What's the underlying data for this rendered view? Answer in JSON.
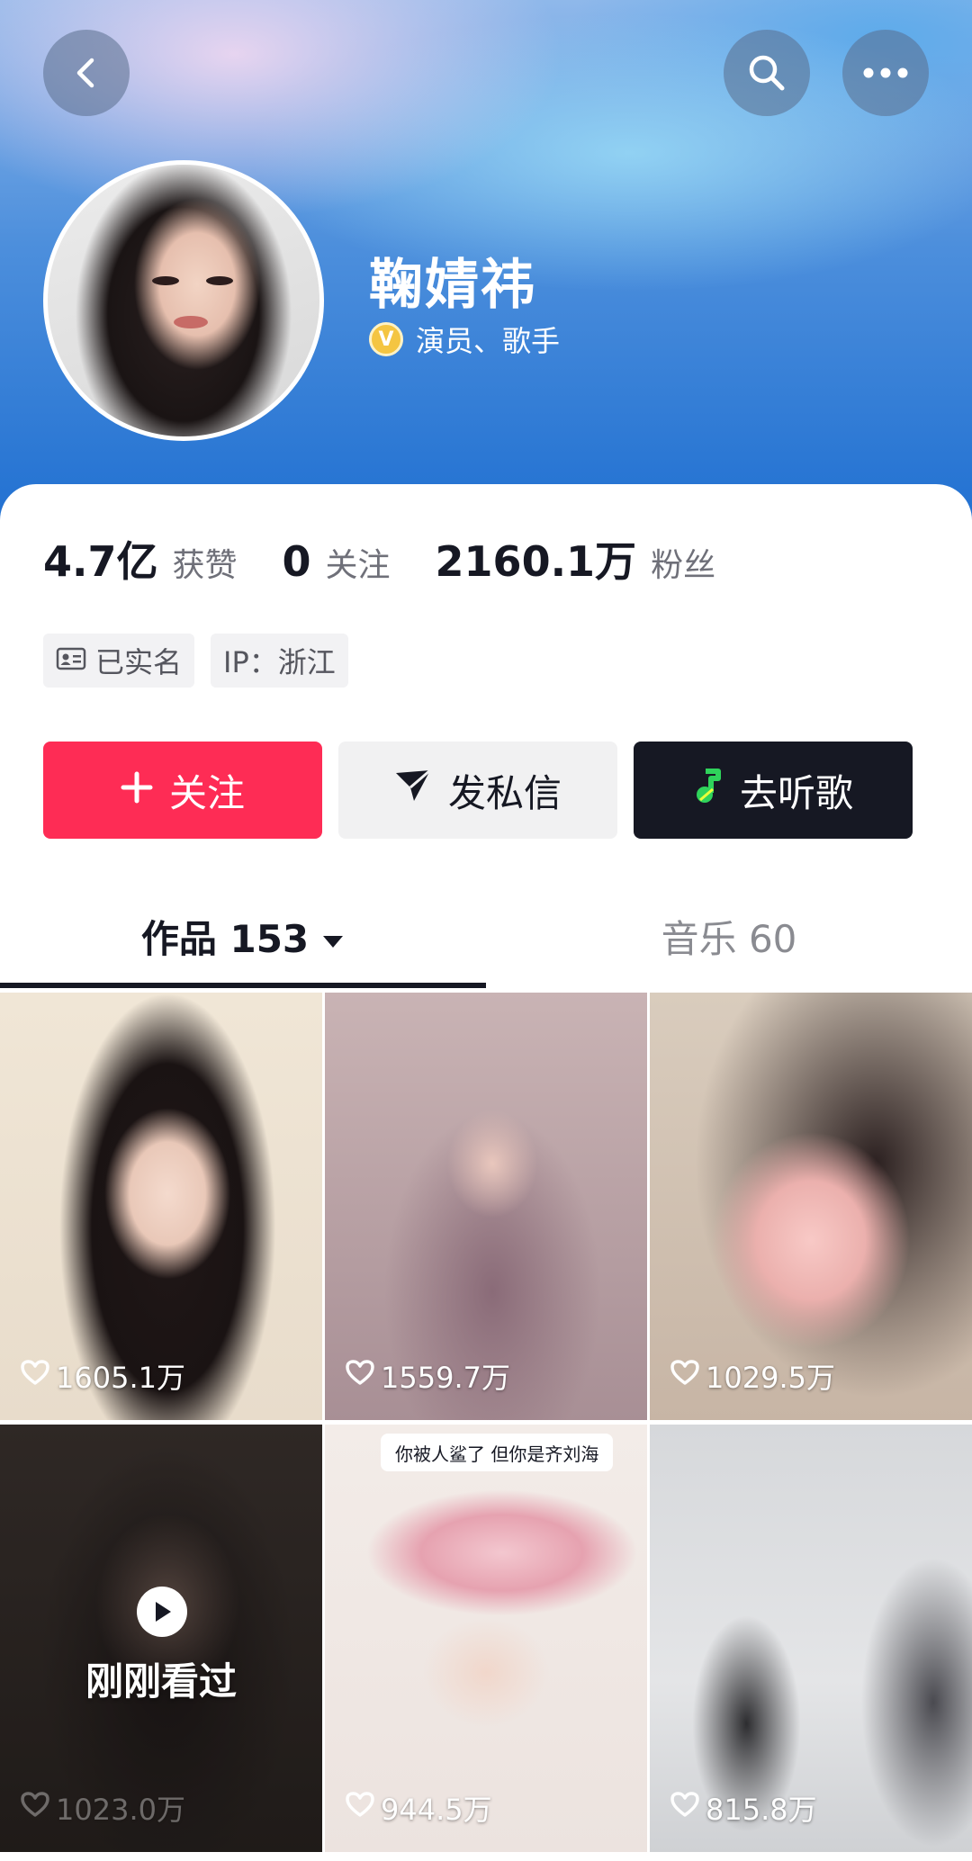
{
  "header": {
    "back_icon": "chevron-left-icon",
    "search_icon": "search-icon",
    "more_icon": "more-horizontal-icon"
  },
  "profile": {
    "name": "鞠婧祎",
    "verified_badge": "V",
    "title": "演员、歌手"
  },
  "stats": {
    "likes_value": "4.7亿",
    "likes_label": "获赞",
    "following_value": "0",
    "following_label": "关注",
    "followers_value": "2160.1万",
    "followers_label": "粉丝"
  },
  "tags": {
    "real_name": "已实名",
    "ip": "IP：浙江"
  },
  "actions": {
    "follow": "关注",
    "message": "发私信",
    "listen": "去听歌"
  },
  "tabs": {
    "works": "作品 153",
    "music": "音乐 60"
  },
  "colors": {
    "follow_button": "#fe2c55",
    "listen_button": "#161823",
    "verify_badge": "#f4c542"
  },
  "videos": [
    {
      "likes": "1605.1万"
    },
    {
      "likes": "1559.7万"
    },
    {
      "likes": "1029.5万"
    },
    {
      "likes": "1023.0万",
      "overlay": "刚刚看过"
    },
    {
      "likes": "944.5万",
      "caption": "你被人鲨了 但你是齐刘海"
    },
    {
      "likes": "815.8万"
    }
  ]
}
